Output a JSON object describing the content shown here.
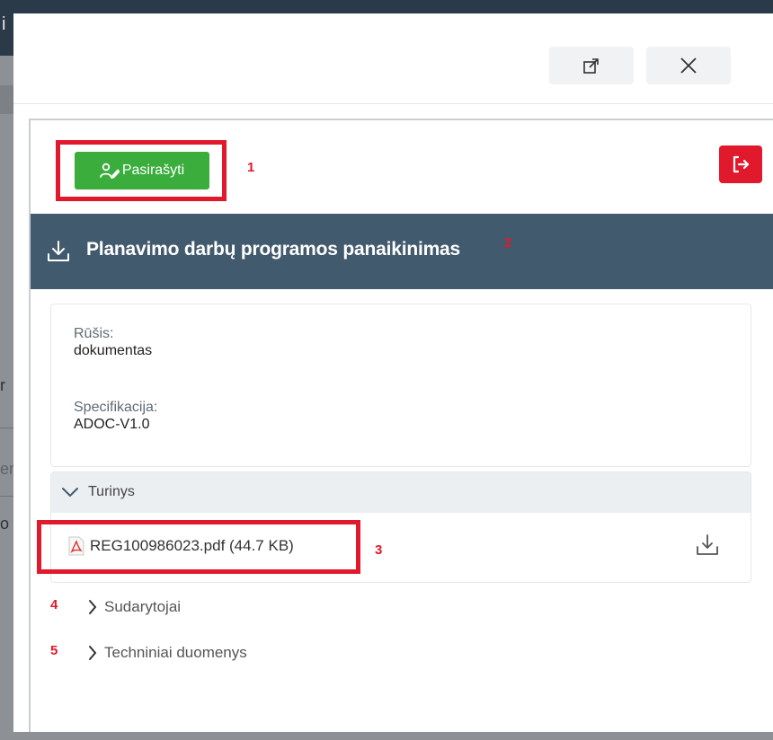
{
  "background": {
    "top_letter": "i",
    "fragments": [
      "r",
      "er",
      "o"
    ]
  },
  "modal": {
    "header": {
      "expand_icon": "expand-icon",
      "close_icon": "close-icon"
    },
    "toolbar": {
      "sign_label": "Pasirašyti",
      "sign_icon": "user-pen-icon",
      "logout_icon": "logout-icon"
    },
    "annotations": [
      "1",
      "2",
      "3",
      "4",
      "5"
    ],
    "document": {
      "title": "Planavimo darbų programos panaikinimas",
      "title_icon": "download-icon",
      "fields": [
        {
          "label": "Rūšis:",
          "value": "dokumentas"
        },
        {
          "label": "Specifikacija:",
          "value": "ADOC-V1.0"
        }
      ]
    },
    "sections": {
      "turinys": {
        "label": "Turinys",
        "expanded": true,
        "files": [
          {
            "name": "REG100986023.pdf (44.7 KB)",
            "icon": "pdf-file-icon"
          }
        ]
      },
      "sudarytojai": {
        "label": "Sudarytojai",
        "expanded": false
      },
      "techniniai": {
        "label": "Techniniai duomenys",
        "expanded": false
      }
    },
    "colors": {
      "sign_green": "#3aad3d",
      "danger_red": "#e1192c",
      "title_bar": "#425a6d"
    }
  }
}
